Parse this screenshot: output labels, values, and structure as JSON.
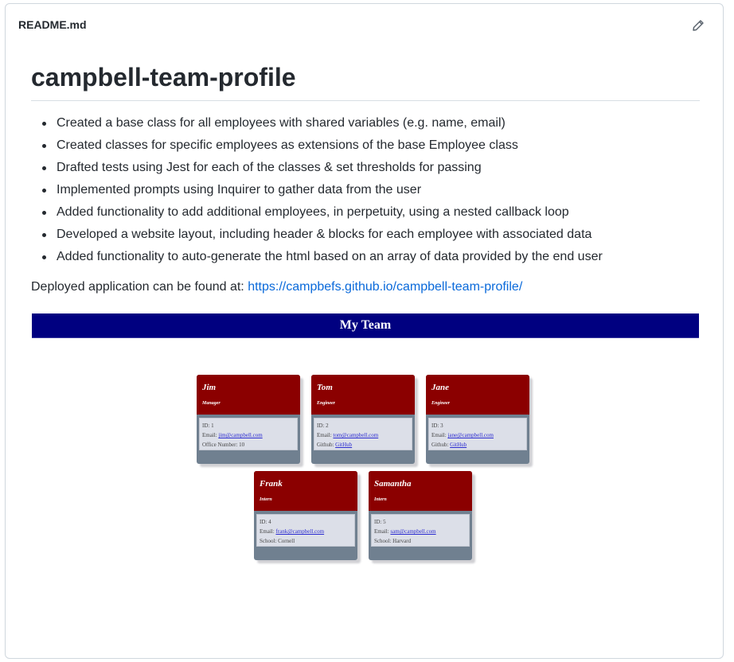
{
  "file": {
    "name": "README.md",
    "edit_icon": "pencil-icon"
  },
  "readme": {
    "title": "campbell-team-profile",
    "features": [
      "Created a base class for all employees with shared variables (e.g. name, email)",
      "Created classes for specific employees as extensions of the base Employee class",
      "Drafted tests using Jest for each of the classes & set thresholds for passing",
      "Implemented prompts using Inquirer to gather data from the user",
      "Added functionality to add additional employees, in perpetuity, using a nested callback loop",
      "Developed a website layout, including header & blocks for each employee with associated data",
      "Added functionality to auto-generate the html based on an array of data provided by the end user"
    ],
    "deploy_text": "Deployed application can be found at:",
    "deploy_link": "https://campbefs.github.io/campbell-team-profile/"
  },
  "screenshot": {
    "header": "My Team",
    "colors": {
      "header_bg": "#000080",
      "card_head": "#8b0000",
      "card_body": "#708090"
    },
    "cards": [
      {
        "name": "Jim",
        "role": "Manager",
        "id": "ID: 1",
        "email_label": "Email:",
        "email": "jim@campbell.com",
        "extra": "Office Number: 10",
        "extra_link": ""
      },
      {
        "name": "Tom",
        "role": "Engineer",
        "id": "ID: 2",
        "email_label": "Email:",
        "email": "tom@campbell.com",
        "extra": "Github:",
        "extra_link": "GitHub"
      },
      {
        "name": "Jane",
        "role": "Engineer",
        "id": "ID: 3",
        "email_label": "Email:",
        "email": "jane@campbell.com",
        "extra": "Github:",
        "extra_link": "GitHub"
      },
      {
        "name": "Frank",
        "role": "Intern",
        "id": "ID: 4",
        "email_label": "Email:",
        "email": "frank@campbell.com",
        "extra": "School: Cornell",
        "extra_link": ""
      },
      {
        "name": "Samantha",
        "role": "Intern",
        "id": "ID: 5",
        "email_label": "Email:",
        "email": "sam@campbell.com",
        "extra": "School: Harvard",
        "extra_link": ""
      }
    ]
  }
}
